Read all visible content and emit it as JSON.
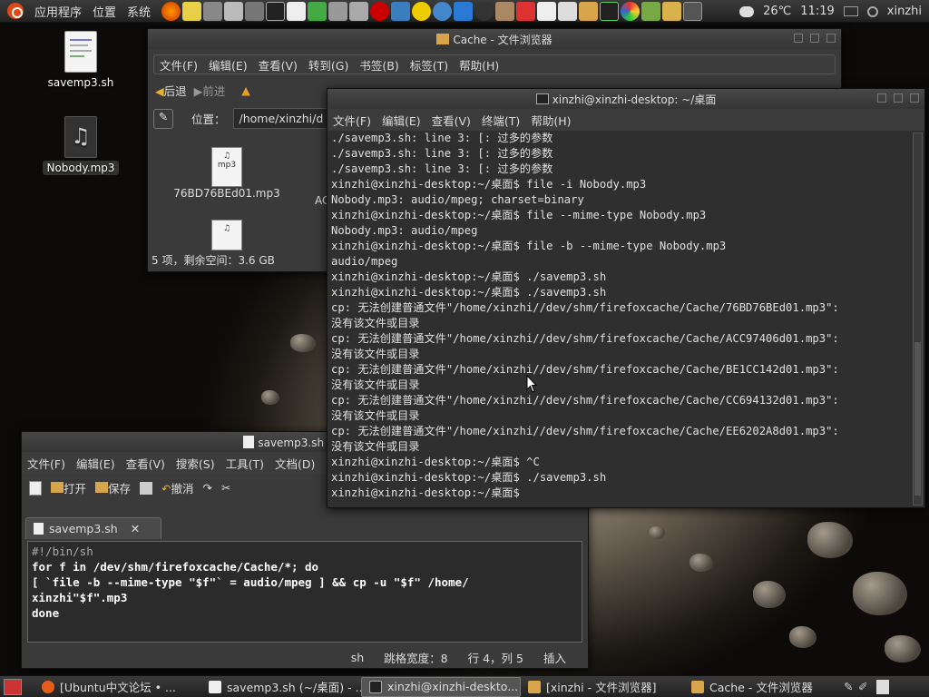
{
  "top_panel": {
    "menus": [
      "应用程序",
      "位置",
      "系统"
    ],
    "weather": "26℃",
    "time": "11:19",
    "user": "xinzhi"
  },
  "desktop": {
    "icons": [
      {
        "label": "savemp3.sh"
      },
      {
        "label": "Nobody.mp3"
      }
    ]
  },
  "file_manager": {
    "title": "Cache - 文件浏览器",
    "menu": [
      "文件(F)",
      "编辑(E)",
      "查看(V)",
      "转到(G)",
      "书签(B)",
      "标签(T)",
      "帮助(H)"
    ],
    "back": "后退",
    "forward": "前进",
    "location_label": "位置：",
    "location": "/home/xinzhi/d",
    "files": [
      "76BD76BEd01.mp3",
      "AC"
    ],
    "status": "5 项，剩余空间：3.6 GB"
  },
  "terminal": {
    "title": "xinzhi@xinzhi-desktop: ~/桌面",
    "menu": [
      "文件(F)",
      "编辑(E)",
      "查看(V)",
      "终端(T)",
      "帮助(H)"
    ],
    "lines": [
      "./savemp3.sh: line 3: [: 过多的参数",
      "./savemp3.sh: line 3: [: 过多的参数",
      "./savemp3.sh: line 3: [: 过多的参数",
      "xinzhi@xinzhi-desktop:~/桌面$ file -i Nobody.mp3",
      "Nobody.mp3: audio/mpeg; charset=binary",
      "xinzhi@xinzhi-desktop:~/桌面$ file --mime-type Nobody.mp3",
      "Nobody.mp3: audio/mpeg",
      "xinzhi@xinzhi-desktop:~/桌面$ file -b --mime-type Nobody.mp3",
      "audio/mpeg",
      "xinzhi@xinzhi-desktop:~/桌面$ ./savemp3.sh",
      "xinzhi@xinzhi-desktop:~/桌面$ ./savemp3.sh",
      "cp: 无法创建普通文件\"/home/xinzhi//dev/shm/firefoxcache/Cache/76BD76BEd01.mp3\":",
      "没有该文件或目录",
      "cp: 无法创建普通文件\"/home/xinzhi//dev/shm/firefoxcache/Cache/ACC97406d01.mp3\":",
      "没有该文件或目录",
      "cp: 无法创建普通文件\"/home/xinzhi//dev/shm/firefoxcache/Cache/BE1CC142d01.mp3\":",
      "没有该文件或目录",
      "cp: 无法创建普通文件\"/home/xinzhi//dev/shm/firefoxcache/Cache/CC694132d01.mp3\":",
      "没有该文件或目录",
      "cp: 无法创建普通文件\"/home/xinzhi//dev/shm/firefoxcache/Cache/EE6202A8d01.mp3\":",
      "没有该文件或目录",
      "xinzhi@xinzhi-desktop:~/桌面$ ^C",
      "xinzhi@xinzhi-desktop:~/桌面$ ./savemp3.sh",
      "xinzhi@xinzhi-desktop:~/桌面$ "
    ]
  },
  "gedit": {
    "title": "savemp3.sh (~/桌面",
    "menu": [
      "文件(F)",
      "编辑(E)",
      "查看(V)",
      "搜索(S)",
      "工具(T)",
      "文档(D)"
    ],
    "open": "打开",
    "save": "保存",
    "undo": "撤消",
    "tab": "savemp3.sh",
    "code": [
      "#!/bin/sh",
      "for f in /dev/shm/firefoxcache/Cache/*; do",
      "    [ `file -b --mime-type \"$f\"` = audio/mpeg ] && cp -u \"$f\" /home/",
      "xinzhi\"$f\".mp3",
      "done"
    ],
    "status_lang": "sh",
    "status_tab": "跳格宽度：8",
    "status_pos": "行 4，列 5",
    "status_mode": "插入"
  },
  "bottom_panel": {
    "tasks": [
      "[Ubuntu中文论坛 • ...",
      "savemp3.sh (~/桌面) - ...",
      "xinzhi@xinzhi-deskto...",
      "[xinzhi - 文件浏览器]",
      "Cache - 文件浏览器"
    ]
  }
}
